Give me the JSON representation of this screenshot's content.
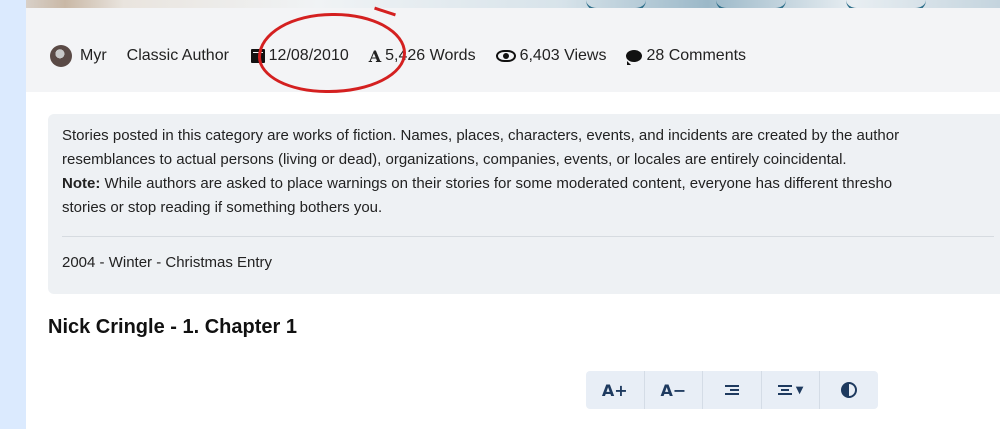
{
  "meta": {
    "author_name": "Myr",
    "category": "Classic Author",
    "date": "12/08/2010",
    "words": "5,426 Words",
    "views": "6,403 Views",
    "comments": "28 Comments"
  },
  "notice": {
    "line1": "Stories posted in this category are works of fiction. Names, places, characters, events, and incidents are created by the author",
    "line2": "resemblances to actual persons (living or dead), organizations, companies, events, or locales are entirely coincidental.",
    "note_label": "Note:",
    "line3": " While authors are asked to place warnings on their stories for some moderated content, everyone has different thresho",
    "line4": "stories or stop reading if something bothers you.",
    "entry": "2004 - Winter - Christmas Entry"
  },
  "story": {
    "title": "Nick Cringle - 1. Chapter 1"
  },
  "toolbar": {
    "increase_font": "A+",
    "decrease_font": "A−"
  },
  "annotation": {
    "color": "#d42020"
  },
  "icons": [
    "avatar",
    "calendar-icon",
    "font-icon",
    "eye-icon",
    "comment-icon",
    "indent-icon",
    "width-icon",
    "contrast-icon"
  ]
}
